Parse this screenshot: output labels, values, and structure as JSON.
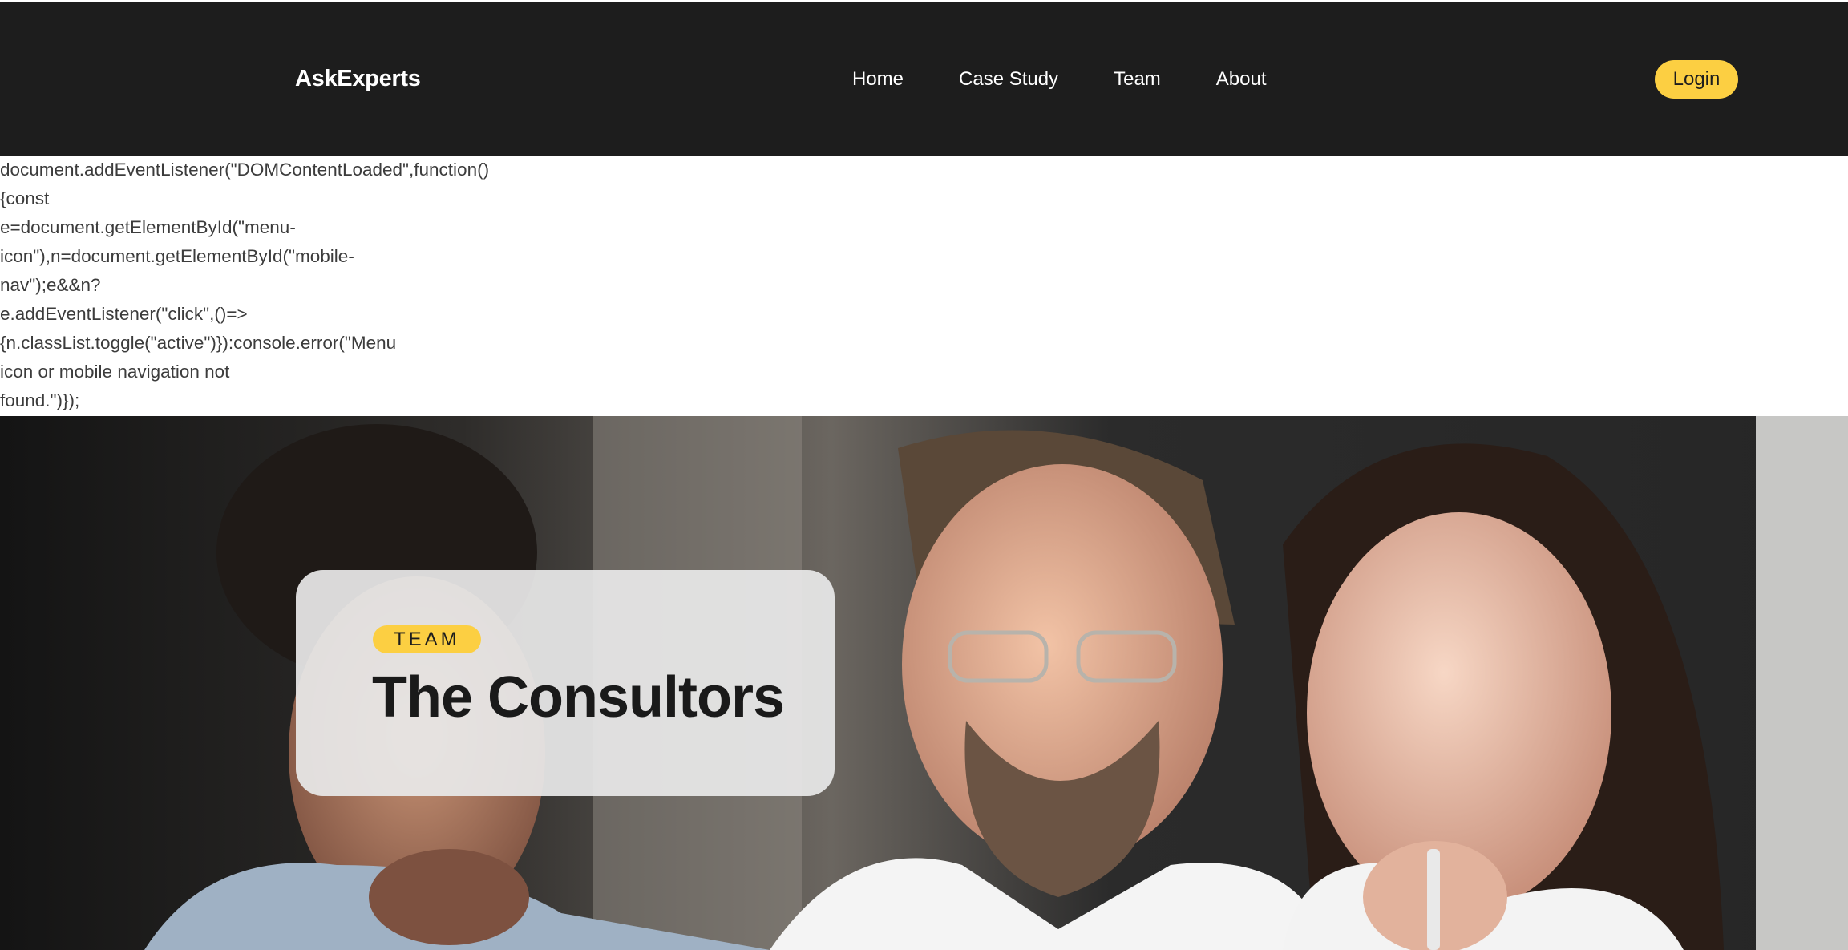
{
  "header": {
    "brand": "AskExperts",
    "nav": [
      "Home",
      "Case Study",
      "Team",
      "About"
    ],
    "login_label": "Login"
  },
  "code_text": {
    "lines": [
      "document.addEventListener(\"DOMContentLoaded\",function()",
      "{const",
      "e=document.getElementById(\"menu-",
      "icon\"),n=document.getElementById(\"mobile-",
      "nav\");e&&n?",
      "e.addEventListener(\"click\",()=>",
      "{n.classList.toggle(\"active\")}):console.error(\"Menu",
      "icon or mobile navigation not",
      "found.\")});"
    ]
  },
  "hero": {
    "eyebrow": "TEAM",
    "title": "The Consultors",
    "image": "team-photo"
  },
  "colors": {
    "navbar_bg": "#1d1d1d",
    "accent": "#fccf42",
    "nav_text": "#ffffff",
    "code_text": "#3c3c3c",
    "card_bg": "#e8e8e8"
  }
}
